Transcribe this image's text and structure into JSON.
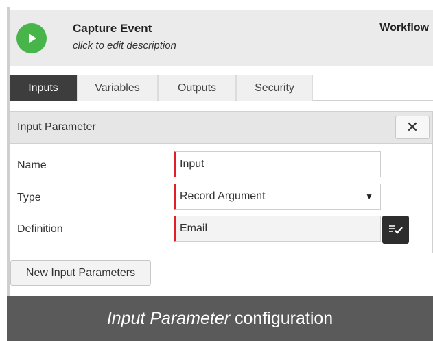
{
  "header": {
    "title": "Capture Event",
    "subtitle": "click to edit description",
    "right_label": "Workflow"
  },
  "tabs": [
    {
      "label": "Inputs",
      "active": true
    },
    {
      "label": "Variables",
      "active": false
    },
    {
      "label": "Outputs",
      "active": false
    },
    {
      "label": "Security",
      "active": false
    }
  ],
  "panel": {
    "title": "Input Parameter",
    "close_symbol": "✕",
    "fields": {
      "name": {
        "label": "Name",
        "value": "Input"
      },
      "type": {
        "label": "Type",
        "value": "Record Argument",
        "arrow": "▼"
      },
      "definition": {
        "label": "Definition",
        "value": "Email"
      }
    }
  },
  "new_button_label": "New Input Parameters",
  "caption": {
    "italic": "Input Parameter",
    "rest": " configuration"
  },
  "colors": {
    "accent_green": "#47b54a",
    "required_red": "#e21f26",
    "dark": "#3d3d3d"
  },
  "icons": [
    "play-icon",
    "close-icon",
    "list-check-icon",
    "dropdown-arrow-icon"
  ]
}
